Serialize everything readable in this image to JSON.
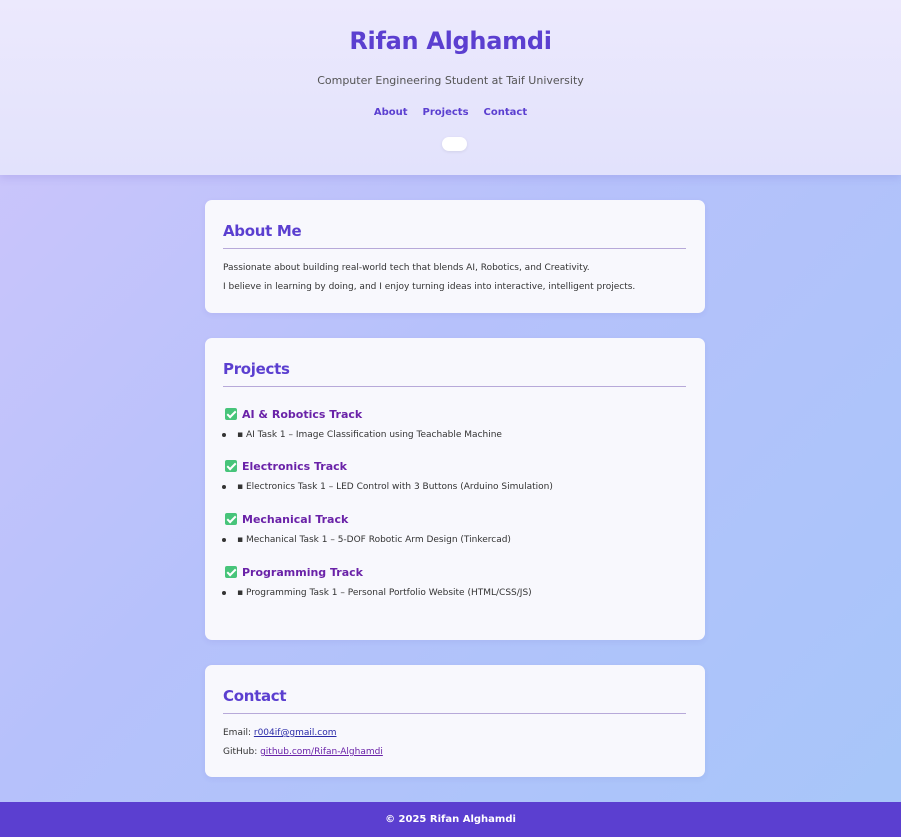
{
  "header": {
    "title": "Rifan Alghamdi",
    "subtitle": "Computer Engineering Student at Taif University",
    "nav": [
      {
        "label": "About"
      },
      {
        "label": "Projects"
      },
      {
        "label": "Contact"
      }
    ]
  },
  "about": {
    "heading": "About Me",
    "line1": "Passionate about building real-world tech that blends AI, Robotics, and Creativity.",
    "line2": "I believe in learning by doing, and I enjoy turning ideas into interactive, intelligent projects."
  },
  "projects": {
    "heading": "Projects",
    "tracks": [
      {
        "title": "AI & Robotics Track",
        "task": "▪ AI Task 1 – Image Classification using Teachable Machine"
      },
      {
        "title": "Electronics Track",
        "task": "▪ Electronics Task 1 – LED Control with 3 Buttons (Arduino Simulation)"
      },
      {
        "title": "Mechanical Track",
        "task": "▪ Mechanical Task 1 – 5-DOF Robotic Arm Design (Tinkercad)"
      },
      {
        "title": "Programming Track",
        "task": "▪ Programming Task 1 – Personal Portfolio Website (HTML/CSS/JS)"
      }
    ]
  },
  "contact": {
    "heading": "Contact",
    "email_label": "Email: ",
    "email": "r004if@gmail.com",
    "github_label": "GitHub: ",
    "github": "github.com/Rifan-Alghamdi"
  },
  "footer": {
    "text": "© 2025 Rifan Alghamdi"
  },
  "colors": {
    "accent": "#5b3fd0",
    "track_title": "#6a22a8",
    "check": "#47c47a"
  }
}
